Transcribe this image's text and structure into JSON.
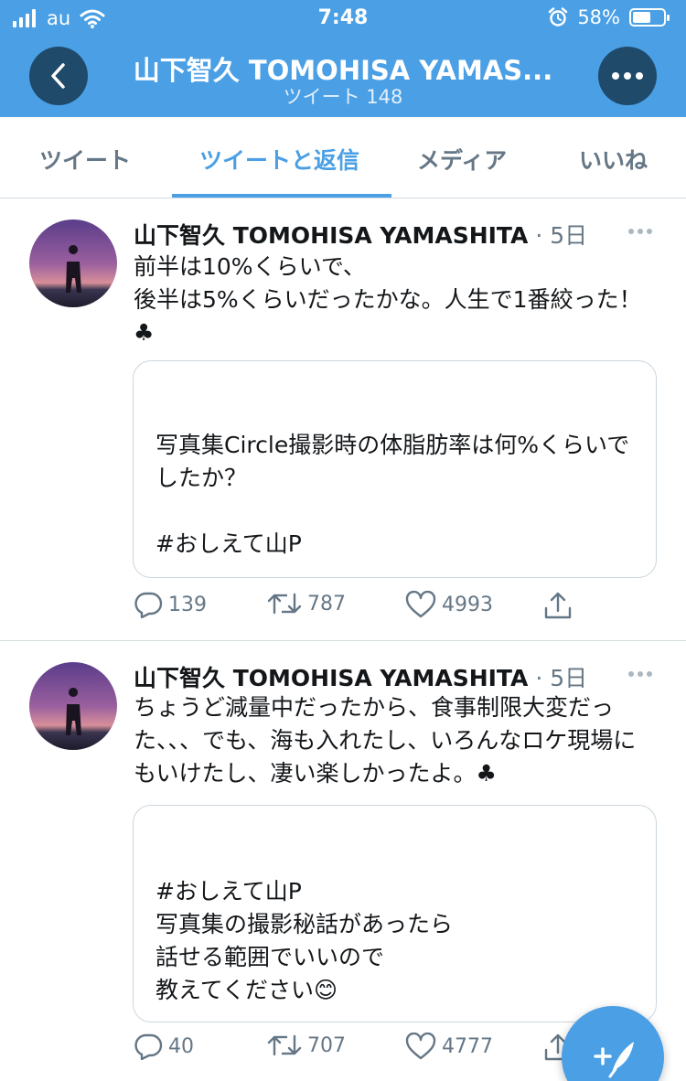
{
  "status_bar": {
    "carrier": "au",
    "time": "7:48",
    "battery": "58%",
    "battery_level": 0.58
  },
  "header": {
    "title": "山下智久 TOMOHISA YAMAS...",
    "subtitle": "ツイート 148"
  },
  "tabs": [
    {
      "label": "ツイート",
      "active": false
    },
    {
      "label": "ツイートと返信",
      "active": true
    },
    {
      "label": "メディア",
      "active": false
    },
    {
      "label": "いいね",
      "active": false
    }
  ],
  "tweets": [
    {
      "name": "山下智久 TOMOHISA YAMASHITA",
      "time": "· 5日",
      "text": "前半は10%くらいで、\n後半は5%くらいだったかな。人生で1番絞った！♣",
      "quote": "写真集Circle撮影時の体脂肪率は何%くらいでしたか？\n\n#おしえて山P",
      "replies": "139",
      "retweets": "787",
      "likes": "4993"
    },
    {
      "name": "山下智久 TOMOHISA YAMASHITA",
      "time": "· 5日",
      "text": "ちょうど減量中だったから、食事制限大変だった、、、でも、海も入れたし、いろんなロケ現場にもいけたし、凄い楽しかったよ。♣",
      "quote": "#おしえて山P\n写真集の撮影秘話があったら\n話せる範囲でいいので\n教えてください😊",
      "replies": "40",
      "retweets": "707",
      "likes": "4777"
    }
  ],
  "colors": {
    "accent": "#4a9fe5",
    "header_button": "#1f4a6a",
    "muted": "#657786",
    "text": "#14171a",
    "border": "#d6dbe0"
  },
  "icons": [
    "back-arrow-icon",
    "more-icon",
    "reply-icon",
    "retweet-icon",
    "like-icon",
    "share-icon",
    "compose-icon",
    "wifi-icon",
    "alarm-icon",
    "battery-icon",
    "signal-icon"
  ]
}
